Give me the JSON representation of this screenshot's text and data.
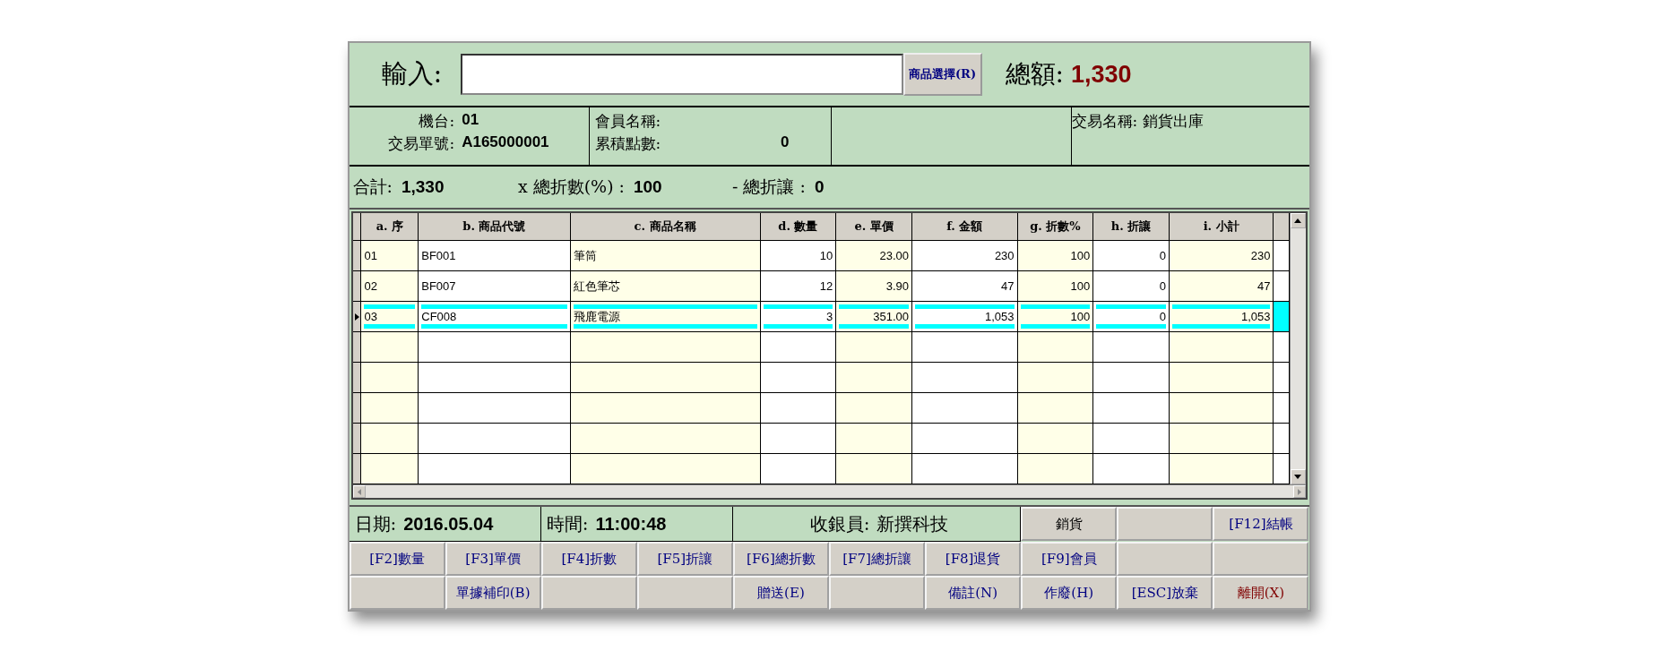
{
  "input": {
    "label": "輸入:",
    "select_button": "商品選擇(R)",
    "total_label": "總額:",
    "total_value": "1,330"
  },
  "info": {
    "machine_label": "機台:",
    "machine_value": "01",
    "order_label": "交易單號:",
    "order_value": "A165000001",
    "member_label": "會員名稱:",
    "points_label": "累積點數:",
    "points_value": "0",
    "trade_label": "交易名稱:",
    "trade_value": "銷貨出庫"
  },
  "totals": {
    "sum_label": "合計:",
    "sum_value": "1,330",
    "discount_rate_label": "x 總折數(%) :",
    "discount_rate_value": "100",
    "discount_label": "- 總折讓 :",
    "discount_value": "0"
  },
  "table": {
    "columns": [
      "a. 序",
      "b. 商品代號",
      "c. 商品名稱",
      "d. 數量",
      "e. 單價",
      "f. 金額",
      "g. 折數%",
      "h. 折讓",
      "i. 小計"
    ],
    "rows": [
      {
        "selected": false,
        "cells": [
          "01",
          "BF001",
          "筆筒",
          "10",
          "23.00",
          "230",
          "100",
          "0",
          "230"
        ]
      },
      {
        "selected": false,
        "cells": [
          "02",
          "BF007",
          "紅色筆芯",
          "12",
          "3.90",
          "47",
          "100",
          "0",
          "47"
        ]
      },
      {
        "selected": true,
        "cells": [
          "03",
          "CF008",
          "飛鹿電源",
          "3",
          "351.00",
          "1,053",
          "100",
          "0",
          "1,053"
        ]
      }
    ]
  },
  "status_bar": {
    "date_label": "日期:",
    "date_value": "2016.05.04",
    "time_label": "時間:",
    "time_value": "11:00:48",
    "cashier_label": "收銀員:",
    "cashier_value": "新撰科技"
  },
  "buttons_top": [
    {
      "kind": "key",
      "label": "銷貨",
      "color": "#000000"
    },
    {
      "kind": "blank"
    },
    {
      "kind": "key",
      "label": "[F12]結帳",
      "color": "#000080"
    }
  ],
  "buttons_row_2": [
    {
      "kind": "key",
      "label": "[F2]數量",
      "color": "#000080"
    },
    {
      "kind": "key",
      "label": "[F3]單價",
      "color": "#000080"
    },
    {
      "kind": "key",
      "label": "[F4]折數",
      "color": "#000080"
    },
    {
      "kind": "key",
      "label": "[F5]折讓",
      "color": "#000080"
    },
    {
      "kind": "key",
      "label": "[F6]總折數",
      "color": "#000080"
    },
    {
      "kind": "key",
      "label": "[F7]總折讓",
      "color": "#000080"
    },
    {
      "kind": "key",
      "label": "[F8]退貨",
      "color": "#000080"
    },
    {
      "kind": "key",
      "label": "[F9]會員",
      "color": "#000080"
    },
    {
      "kind": "blank"
    },
    {
      "kind": "blank"
    }
  ],
  "buttons_row_3": [
    {
      "kind": "blank"
    },
    {
      "kind": "key",
      "label": "單據補印(B)",
      "color": "#000080"
    },
    {
      "kind": "blank"
    },
    {
      "kind": "blank"
    },
    {
      "kind": "key",
      "label": "贈送(E)",
      "color": "#000080"
    },
    {
      "kind": "blank"
    },
    {
      "kind": "key",
      "label": "備註(N)",
      "color": "#000080"
    },
    {
      "kind": "key",
      "label": "作廢(H)",
      "color": "#000080"
    },
    {
      "kind": "key",
      "label": "[ESC]放棄",
      "color": "#000080"
    },
    {
      "kind": "key",
      "label": "離開(X)",
      "color": "#800000"
    }
  ]
}
